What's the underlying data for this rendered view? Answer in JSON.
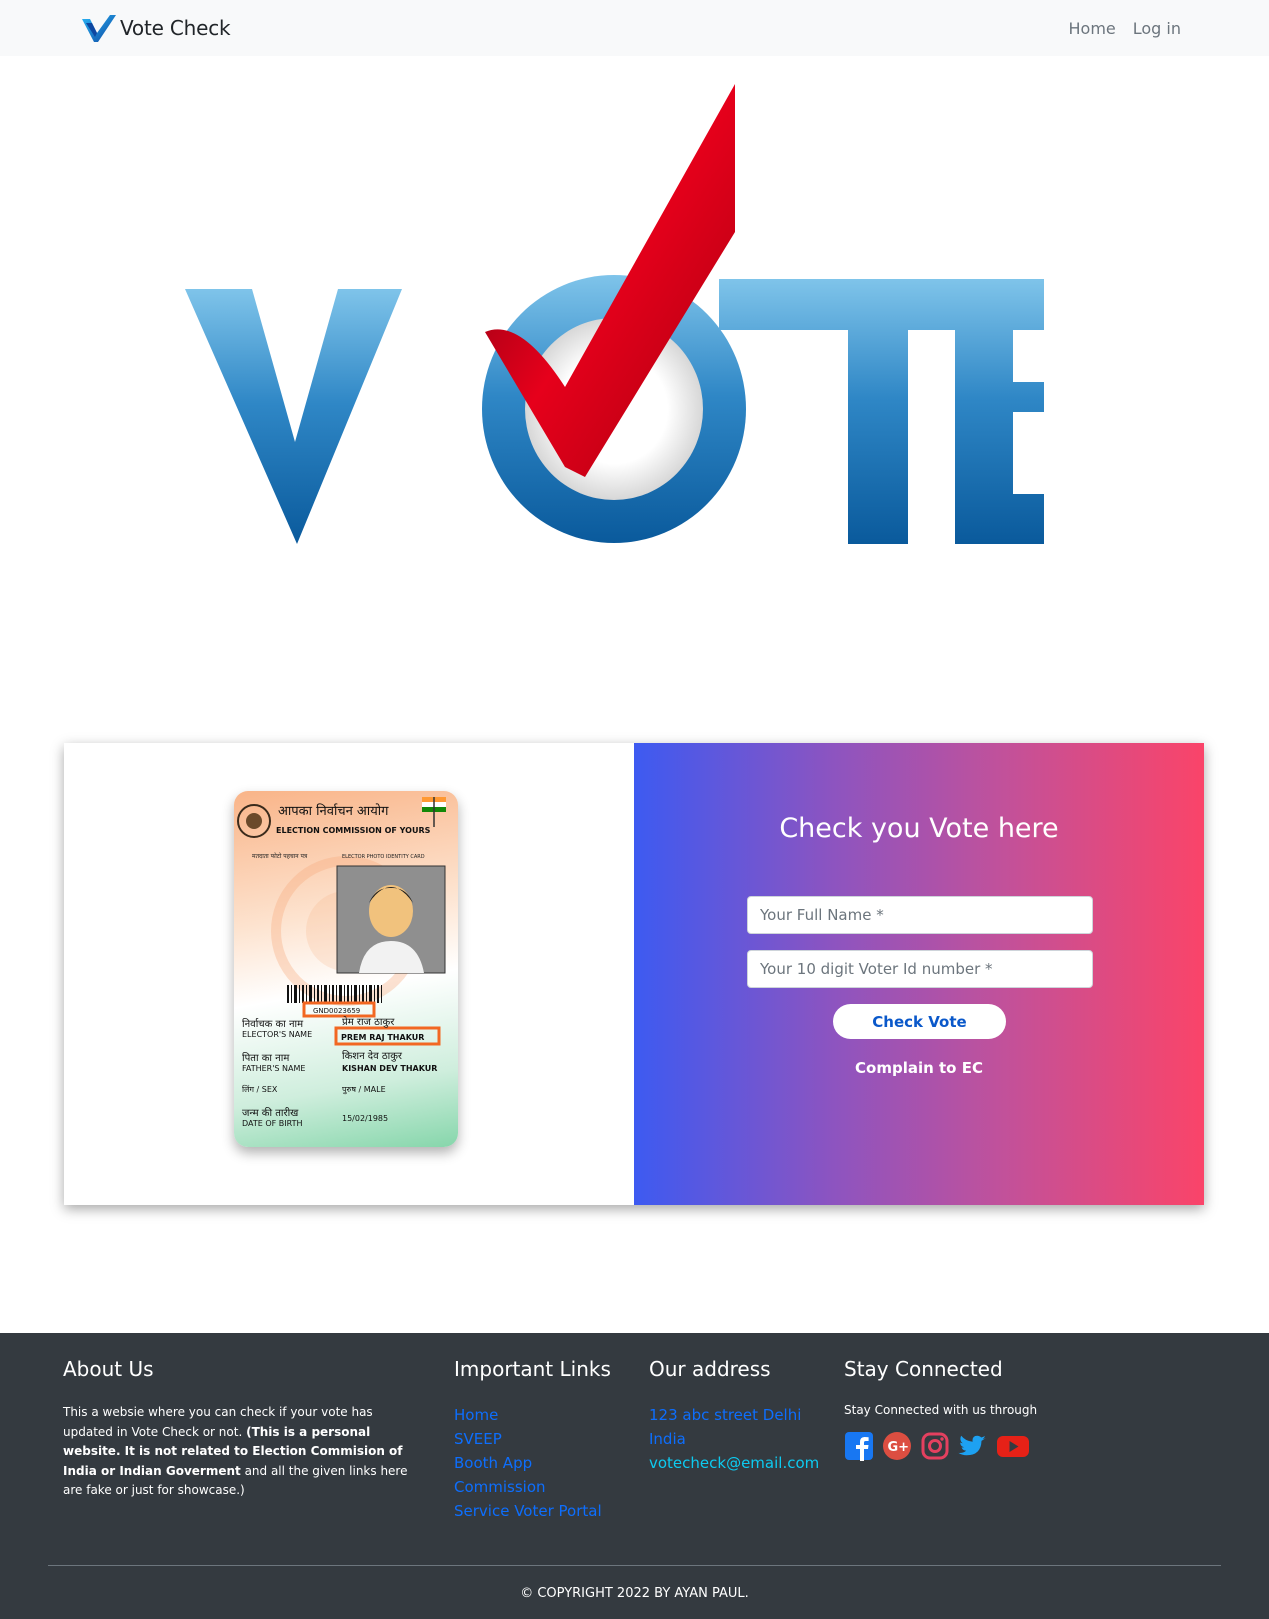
{
  "navbar": {
    "brand": "Vote Check",
    "links": [
      "Home",
      "Log in"
    ]
  },
  "voter_card": {
    "hindi_title": "आपका निर्वाचन आयोग",
    "title": "ELECTION COMMISSION OF YOURS",
    "subtitle_left": "मतदाता फोटो पहचान पत्र",
    "subtitle_right": "ELECTOR PHOTO IDENTITY CARD",
    "id_number": "GND0023659",
    "elector_label_hi": "निर्वाचक का नाम",
    "elector_label": "ELECTOR'S NAME",
    "elector_name_hi": "प्रेम राज ठाकुर",
    "elector_name": "PREM RAJ THAKUR",
    "father_label_hi": "पिता का नाम",
    "father_label": "FATHER'S NAME",
    "father_name_hi": "किशन देव ठाकुर",
    "father_name": "KISHAN DEV THAKUR",
    "sex_label": "लिंग / SEX",
    "sex_value": "पुरुष / MALE",
    "dob_label_hi": "जन्म की तारीख",
    "dob_label": "DATE OF BIRTH",
    "dob_value": "15/02/1985"
  },
  "form": {
    "title": "Check you Vote here",
    "name_placeholder": "Your Full Name *",
    "id_placeholder": "Your 10 digit Voter Id number *",
    "submit_label": "Check Vote",
    "complain_label": "Complain to EC"
  },
  "footer": {
    "about": {
      "heading": "About Us",
      "text_start": "This a websie where you can check if your vote has updated in Vote Check or not. ",
      "text_bold": "(This is a personal website. It is not related to Election Commision of India or Indian Goverment",
      "text_end": " and all the given links here are fake or just for showcase.)"
    },
    "links": {
      "heading": "Important Links",
      "items": [
        "Home",
        "SVEEP",
        "Booth App",
        "Commission",
        "Service Voter Portal"
      ]
    },
    "address": {
      "heading": "Our address",
      "line1": "123 abc street Delhi",
      "line2": "India",
      "email": "votecheck@email.com"
    },
    "stay": {
      "heading": "Stay Connected",
      "text": "Stay Connected with us through",
      "icons": [
        "facebook-icon",
        "google-plus-icon",
        "instagram-icon",
        "twitter-icon",
        "youtube-icon"
      ]
    },
    "copyright": "© COPYRIGHT 2022 BY AYAN PAUL."
  },
  "colors": {
    "accent_blue": "#0d6efd",
    "footer_bg": "#343a40",
    "gradient_start": "#3d5af1",
    "gradient_end": "#fa4469"
  }
}
